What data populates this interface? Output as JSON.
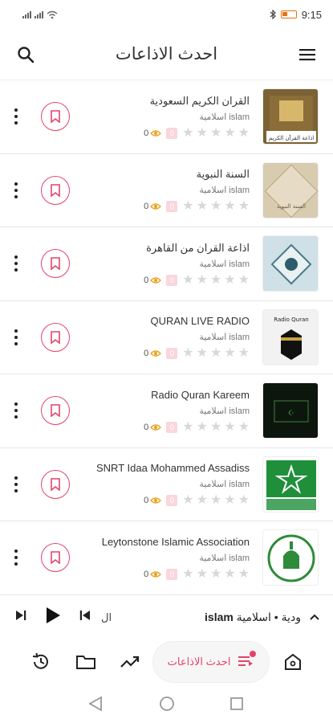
{
  "status_bar": {
    "time": "9:15",
    "signal_labels": [
      "4G",
      "4G"
    ]
  },
  "header": {
    "title": "احدث الاذاعات"
  },
  "stations": [
    {
      "name": "القران الكريم السعودية",
      "category": "اسلامية islam",
      "views": "0",
      "rating": "0",
      "stars": 5,
      "thumb_caption": "اذاعة القرآن الكريم",
      "thumb_bg": "#7a6234"
    },
    {
      "name": "السنة النبوية",
      "category": "اسلامية islam",
      "views": "0",
      "rating": "0",
      "stars": 5,
      "thumb_caption": "السنة النبوية",
      "thumb_bg": "#d8cbb0"
    },
    {
      "name": "اذاعة القران من القاهرة",
      "category": "اسلامية islam",
      "views": "0",
      "rating": "0",
      "stars": 5,
      "thumb_caption": "",
      "thumb_bg": "#bcd3dc"
    },
    {
      "name": "QURAN LIVE RADIO",
      "category": "اسلامية islam",
      "views": "0",
      "rating": "0",
      "stars": 5,
      "thumb_caption": "Radio Quran",
      "thumb_bg": "#f2f2f2"
    },
    {
      "name": "Radio Quran Kareem",
      "category": "اسلامية islam",
      "views": "0",
      "rating": "0",
      "stars": 5,
      "thumb_caption": "",
      "thumb_bg": "#0f1a0f"
    },
    {
      "name": "SNRT Idaa Mohammed Assadiss",
      "category": "اسلامية islam",
      "views": "0",
      "rating": "0",
      "stars": 5,
      "thumb_caption": "",
      "thumb_bg": "#ffffff"
    },
    {
      "name": "Leytonstone Islamic Association",
      "category": "اسلامية islam",
      "views": "0",
      "rating": "0",
      "stars": 5,
      "thumb_caption": "",
      "thumb_bg": "#ffffff"
    }
  ],
  "mini_player": {
    "now_playing_bold": "islam",
    "now_playing_rest": "ودية • اسلامية",
    "prefix": "ال"
  },
  "bottom_nav": {
    "active_label": "احدث الاذاعات"
  },
  "colors": {
    "accent": "#e3446a",
    "star_empty": "#d8d8d8",
    "badge_bg": "#fbd6dd"
  }
}
